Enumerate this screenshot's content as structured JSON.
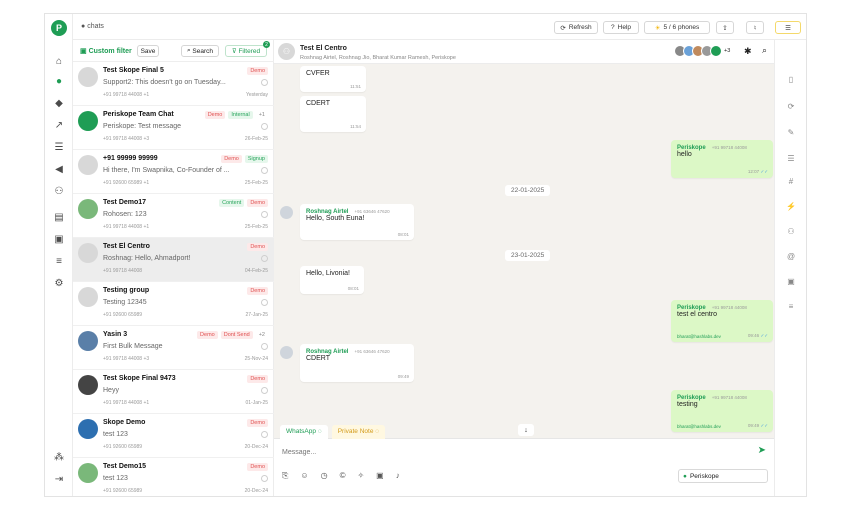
{
  "topbar": {
    "crumb": "chats",
    "refresh": "Refresh",
    "help": "Help",
    "phones": "5 / 6 phones"
  },
  "listhead": {
    "custom_filter": "Custom filter",
    "save": "Save",
    "search": "Search",
    "filtered": "Filtered",
    "filtered_count": "2"
  },
  "chats": [
    {
      "name": "Test Skope Final 5",
      "msg": "Support2: This doesn't go on Tuesday...",
      "phone": "+91 99718 44008 +1",
      "time": "Yesterday",
      "tags": [
        "Demo"
      ]
    },
    {
      "name": "Periskope Team Chat",
      "msg": "Periskope: Test message",
      "phone": "+91 99718 44008 +3",
      "time": "26-Feb-25",
      "tags": [
        "Demo",
        "Internal",
        "+1"
      ]
    },
    {
      "name": "+91 99999 99999",
      "msg": "Hi there, I'm Swapnika, Co-Founder of ...",
      "phone": "+91 92600 65989 +1",
      "time": "25-Feb-25",
      "tags": [
        "Demo",
        "Signup"
      ]
    },
    {
      "name": "Test Demo17",
      "msg": "Rohosen: 123",
      "phone": "+91 99718 44008 +1",
      "time": "25-Feb-25",
      "tags": [
        "Content",
        "Demo"
      ]
    },
    {
      "name": "Test El Centro",
      "msg": "Roshnag: Hello, Ahmadport!",
      "phone": "+91 99718 44008",
      "time": "04-Feb-25",
      "tags": [
        "Demo"
      ]
    },
    {
      "name": "Testing group",
      "msg": "Testing 12345",
      "phone": "+91 92600 65989",
      "time": "27-Jan-25",
      "tags": [
        "Demo"
      ]
    },
    {
      "name": "Yasin 3",
      "msg": "First Bulk Message",
      "phone": "+91 99718 44008 +3",
      "time": "25-Nov-24",
      "tags": [
        "Demo",
        "Dont Send",
        "+2"
      ]
    },
    {
      "name": "Test Skope Final 9473",
      "msg": "Heyy",
      "phone": "+91 99718 44008 +1",
      "time": "01-Jan-25",
      "tags": [
        "Demo"
      ]
    },
    {
      "name": "Skope Demo",
      "msg": "test 123",
      "phone": "+91 92600 65989",
      "time": "20-Dec-24",
      "tags": [
        "Demo"
      ]
    },
    {
      "name": "Test Demo15",
      "msg": "test 123",
      "phone": "+91 92600 65989",
      "time": "20-Dec-24",
      "tags": [
        "Demo"
      ]
    }
  ],
  "chat": {
    "title": "Test El Centro",
    "subtitle": "Roshnag Airtel, Roshnag Jio, Bharat Kumar Ramesh, Periskope",
    "members_extra": "+3",
    "messages": [
      {
        "text": "CVFER",
        "time": "11:51"
      },
      {
        "text": "CDERT",
        "time": "11:54"
      },
      {
        "sender": "Periskope",
        "phone": "+91 99718 44008",
        "text": "hello",
        "time": "12:07"
      },
      {
        "date": "22-01-2025"
      },
      {
        "sender": "Roshnag Airtel",
        "phone": "+91 63646 47620",
        "text": "Hello, South Euna!",
        "time": "08:01"
      },
      {
        "date": "23-01-2025"
      },
      {
        "text": "Hello, Livonia!",
        "time": "08:01"
      },
      {
        "sender": "Periskope",
        "phone": "+91 99718 44008",
        "text": "test el centro",
        "email": "bharat@hashlabs.dev",
        "time": "09:46"
      },
      {
        "sender": "Roshnag Airtel",
        "phone": "+91 63646 47620",
        "text": "CDERT",
        "time": "09:49"
      },
      {
        "sender": "Periskope",
        "phone": "+91 99718 44008",
        "text": "testing",
        "email": "bharat@hashlabs.dev",
        "time": "09:49"
      }
    ],
    "tab_whatsapp": "WhatsApp",
    "tab_private": "Private Note",
    "placeholder": "Message...",
    "sender_select": "Periskope"
  }
}
